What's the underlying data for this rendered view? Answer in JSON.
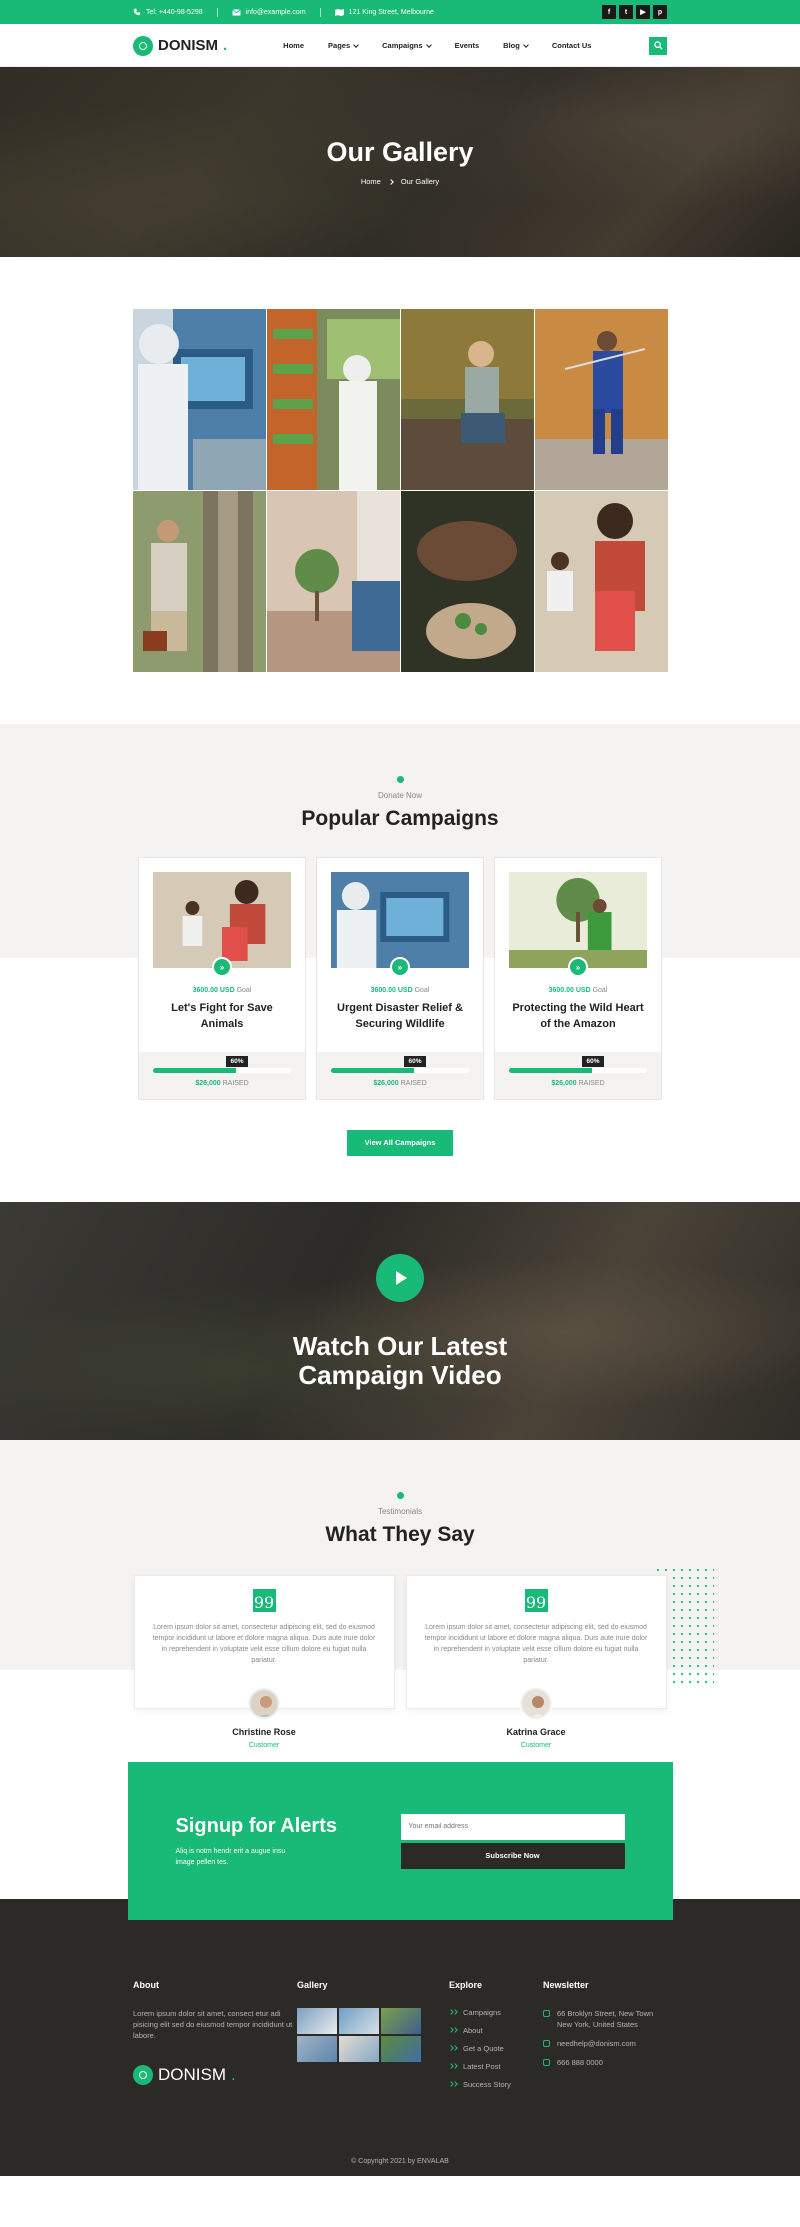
{
  "topbar": {
    "phone": "Tel: +440-98-5298",
    "email": "info@example.com",
    "address": "121 King Street, Melbourne",
    "social": [
      "facebook-icon",
      "twitter-icon",
      "youtube-icon",
      "pinterest-icon"
    ],
    "social_glyphs": [
      "f",
      "t",
      "▶",
      "p"
    ]
  },
  "nav": {
    "logo": "DONISM",
    "logo_dot": ".",
    "items": [
      {
        "label": "Home",
        "dropdown": false
      },
      {
        "label": "Pages",
        "dropdown": true
      },
      {
        "label": "Campaigns",
        "dropdown": true
      },
      {
        "label": "Events",
        "dropdown": false
      },
      {
        "label": "Blog",
        "dropdown": true
      },
      {
        "label": "Contact Us",
        "dropdown": false
      }
    ]
  },
  "hero": {
    "title": "Our Gallery",
    "crumb_home": "Home",
    "crumb_current": "Our Gallery"
  },
  "campaigns": {
    "pretitle": "Donate Now",
    "title": "Popular Campaigns",
    "cards": [
      {
        "goal": "3600.00 USD",
        "goal_label": "Goal",
        "title": "Let's Fight for Save Animals",
        "percent": 60,
        "percent_label": "60%",
        "raised": "$26,000",
        "raised_label": "RAISED"
      },
      {
        "goal": "3600.00 USD",
        "goal_label": "Goal",
        "title": "Urgent Disaster Relief & Securing Wildlife",
        "percent": 60,
        "percent_label": "60%",
        "raised": "$26,000",
        "raised_label": "RAISED"
      },
      {
        "goal": "3600.00 USD",
        "goal_label": "Goal",
        "title": "Protecting the Wild Heart of the Amazon",
        "percent": 60,
        "percent_label": "60%",
        "raised": "$26,000",
        "raised_label": "RAISED"
      }
    ],
    "button": "View All Campaigns"
  },
  "video": {
    "title_line1": "Watch Our Latest",
    "title_line2": "Campaign Video"
  },
  "testimonials": {
    "pretitle": "Testimonials",
    "title": "What They Say",
    "items": [
      {
        "text": "Lorem ipsum dolor sit amet, consectetur adipiscing elit, sed do eiusmod tempor incididunt ut labore et dolore magna aliqua. Duis aute irure dolor in reprehenderit in voluptate velit esse cillum dolore eu fugiat nulla pariatur.",
        "name": "Christine Rose",
        "role": "Customer"
      },
      {
        "text": "Lorem ipsum dolor sit amet, consectetur adipiscing elit, sed do eiusmod tempor incididunt ut labore et dolore magna aliqua. Duis aute irure dolor in reprehenderit in voluptate velit esse cillum dolore eu fugiat nulla pariatur.",
        "name": "Katrina Grace",
        "role": "Customer"
      }
    ]
  },
  "signup": {
    "title": "Signup for Alerts",
    "text": "Aliq is notm hendr erit a augue insu image pellen tes.",
    "placeholder": "Your email address",
    "button": "Subscribe Now"
  },
  "footer": {
    "about_title": "About",
    "about_text": "Lorem ipsum dolor sit amet, consect etur adi pisicing elit sed do eiusmod tempor incididunt ut labore.",
    "logo": "DONISM",
    "logo_dot": ".",
    "gallery_title": "Gallery",
    "explore_title": "Explore",
    "explore": [
      "Campaigns",
      "About",
      "Get a Quote",
      "Latest Post",
      "Success Story"
    ],
    "newsletter_title": "Newsletter",
    "address": "66 Broklyn Street, New Town New York, United States",
    "email": "needhelp@donism.com",
    "phone": "666 888 0000",
    "copyright": "© Copyright 2021 by ENVALAB"
  },
  "colors": {
    "accent": "#19b977",
    "dark": "#2c2a27",
    "light_bg": "#f4f3f1"
  }
}
